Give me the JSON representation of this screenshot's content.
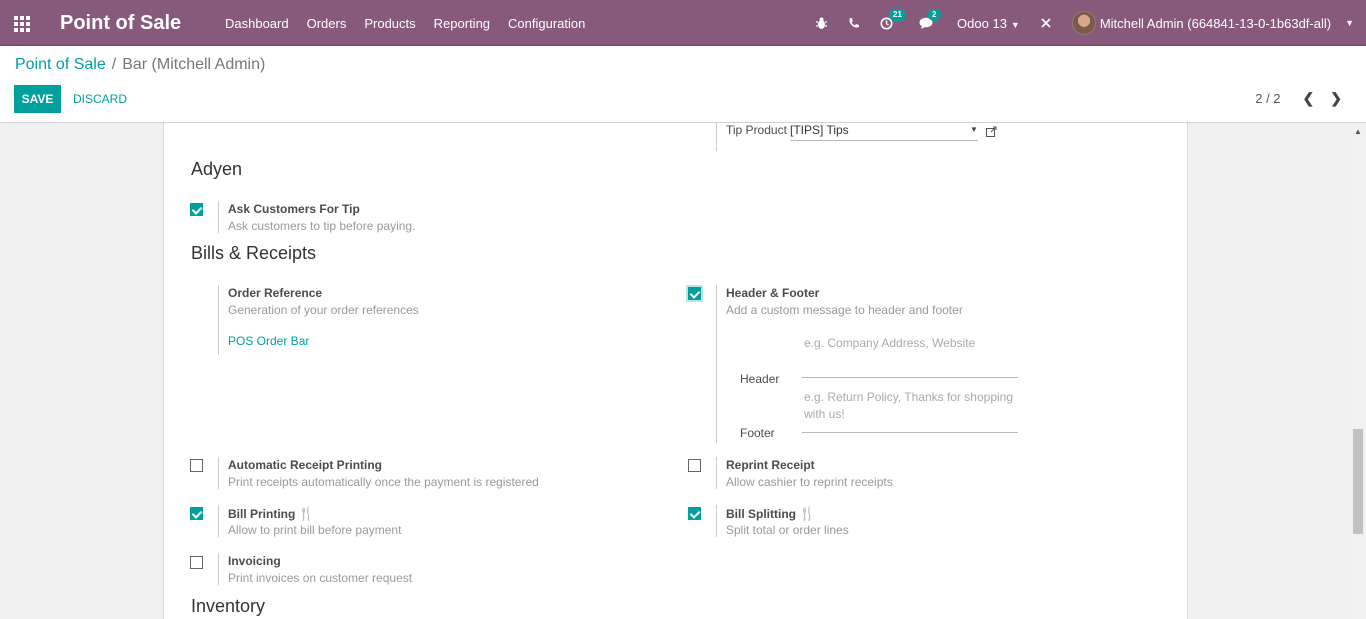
{
  "navbar": {
    "app_title": "Point of Sale",
    "menu": [
      "Dashboard",
      "Orders",
      "Products",
      "Reporting",
      "Configuration"
    ],
    "activity_count": "21",
    "messages_count": "2",
    "db_name": "Odoo 13",
    "user_name": "Mitchell Admin (664841-13-0-1b63df-all)"
  },
  "breadcrumb": {
    "parent": "Point of Sale",
    "separator": "/",
    "current": "Bar (Mitchell Admin)"
  },
  "actions": {
    "save": "SAVE",
    "discard": "DISCARD"
  },
  "pager": {
    "value": "2 / 2"
  },
  "tips": {
    "label": "Tip Product",
    "value": "[TIPS] Tips"
  },
  "sections": {
    "adyen": "Adyen",
    "bills": "Bills & Receipts",
    "inventory": "Inventory"
  },
  "settings": {
    "ask_tip": {
      "title": "Ask Customers For Tip",
      "desc": "Ask customers to tip before paying.",
      "checked": true
    },
    "order_ref": {
      "title": "Order Reference",
      "desc": "Generation of your order references",
      "link": "POS Order Bar"
    },
    "header_footer": {
      "title": "Header & Footer",
      "desc": "Add a custom message to header and footer",
      "checked": true,
      "header_label": "Header",
      "header_placeholder": "e.g. Company Address, Website",
      "footer_label": "Footer",
      "footer_placeholder": "e.g. Return Policy, Thanks for shopping with us!"
    },
    "auto_receipt": {
      "title": "Automatic Receipt Printing",
      "desc": "Print receipts automatically once the payment is registered",
      "checked": false
    },
    "reprint": {
      "title": "Reprint Receipt",
      "desc": "Allow cashier to reprint receipts",
      "checked": false
    },
    "bill_printing": {
      "title": "Bill Printing",
      "desc": "Allow to print bill before payment",
      "checked": true
    },
    "bill_splitting": {
      "title": "Bill Splitting",
      "desc": "Split total or order lines",
      "checked": true
    },
    "invoicing": {
      "title": "Invoicing",
      "desc": "Print invoices on customer request",
      "checked": false
    }
  },
  "colors": {
    "brand": "#875a7b",
    "accent": "#00a09d"
  }
}
